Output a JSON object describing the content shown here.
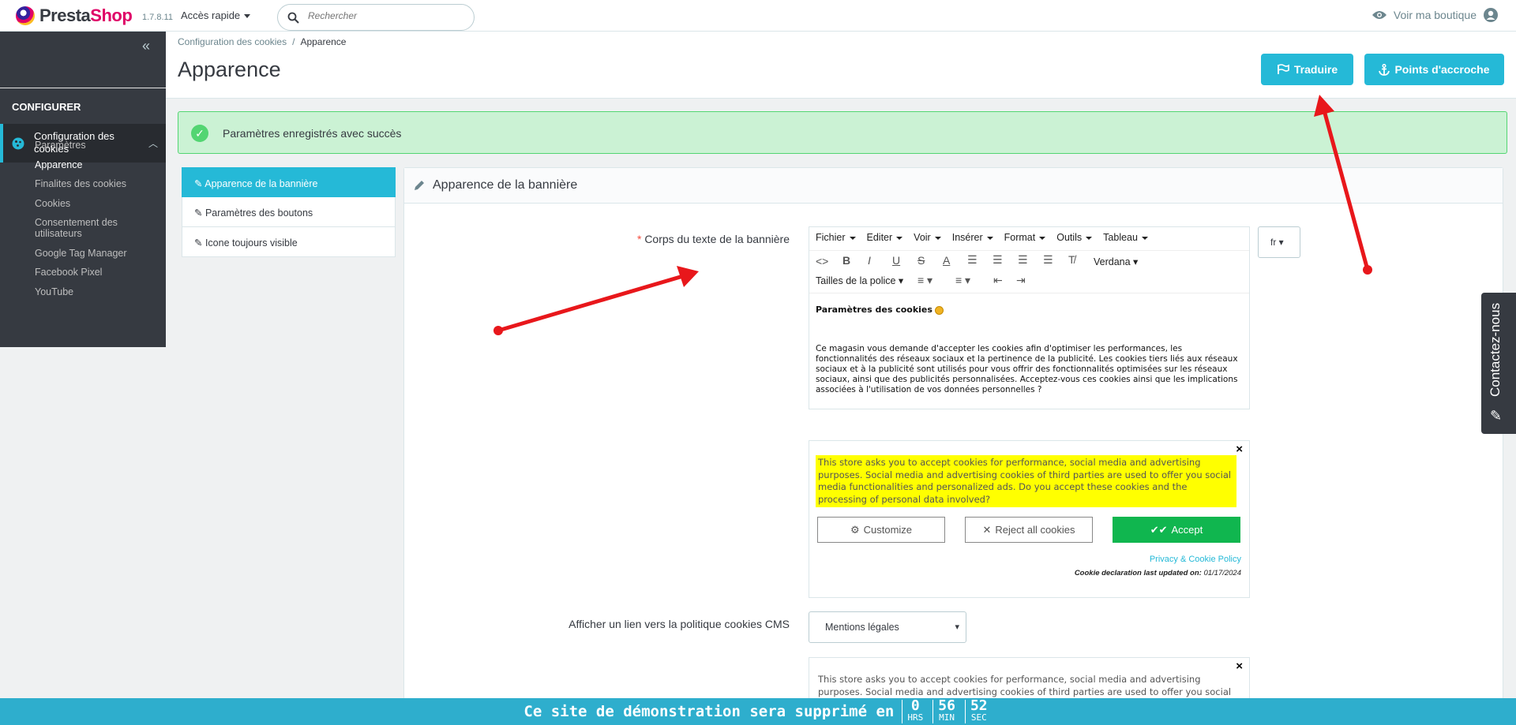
{
  "topbar": {
    "logo_prefix": "Presta",
    "logo_suffix": "Shop",
    "version": "1.7.8.11",
    "quick_access": "Accès rapide",
    "search_placeholder": "Rechercher",
    "view_shop": "Voir ma boutique"
  },
  "sidebar": {
    "section": "CONFIGURER",
    "active_item": "Configuration des cookies",
    "items": [
      "Paramètres",
      "Apparence",
      "Finalites des cookies",
      "Cookies",
      "Consentement des utilisateurs",
      "Google Tag Manager",
      "Facebook Pixel",
      "YouTube"
    ]
  },
  "header": {
    "breadcrumb_parent": "Configuration des cookies",
    "breadcrumb_sep": "/",
    "breadcrumb_current": "Apparence",
    "title": "Apparence",
    "translate_btn": "Traduire",
    "hooks_btn": "Points d'accroche"
  },
  "alert": {
    "text": "Paramètres enregistrés avec succès"
  },
  "tabs": [
    "Apparence de la bannière",
    "Paramètres des boutons",
    "Icone toujours visible"
  ],
  "panel": {
    "title": "Apparence de la bannière",
    "field_label": "Corps du texte de la bannière",
    "required_mark": "*",
    "lang": "fr"
  },
  "editor": {
    "menus": [
      "Fichier",
      "Editer",
      "Voir",
      "Insérer",
      "Format",
      "Outils",
      "Tableau"
    ],
    "font": "Verdana",
    "font_sizes": "Tailles de la police",
    "heading": "Paramètres des cookies",
    "body": "Ce magasin vous demande d'accepter les cookies afin d'optimiser les performances, les fonctionnalités des réseaux sociaux et la pertinence de la publicité. Les cookies tiers liés aux réseaux sociaux et à la publicité sont utilisés pour vous offrir des fonctionnalités optimisées sur les réseaux sociaux, ainsi que des publicités personnalisées. Acceptez-vous ces cookies ainsi que les implications associées à l'utilisation de vos données personnelles ?"
  },
  "preview": {
    "close": "×",
    "text": "This store asks you to accept cookies for performance, social media and advertising purposes. Social media and advertising cookies of third parties are used to offer you social media functionalities and personalized ads. Do you accept these cookies and the processing of personal data involved?",
    "customize": "Customize",
    "reject": "Reject all cookies",
    "accept": "Accept",
    "policy_link": "Privacy & Cookie Policy",
    "decl_label": "Cookie declaration last updated on:",
    "decl_date": "01/17/2024",
    "highlight_color": "#ffff00",
    "accept_color": "#10b64f"
  },
  "cms": {
    "label": "Afficher un lien vers la politique cookies CMS",
    "selected": "Mentions légales"
  },
  "preview2": {
    "text": "This store asks you to accept cookies for performance, social media and advertising purposes. Social media and advertising cookies of third parties are used to offer you social media"
  },
  "contact": {
    "label": "Contactez-nous"
  },
  "demo": {
    "message": "Ce site de démonstration sera supprimé en",
    "hrs": "0",
    "hrs_label": "HRS",
    "min": "56",
    "min_label": "MIN",
    "sec": "52",
    "sec_label": "SEC"
  },
  "colors": {
    "accent": "#25b9d7",
    "sidebar": "#363a41",
    "success": "#53d572",
    "annotation": "#e8171b"
  }
}
